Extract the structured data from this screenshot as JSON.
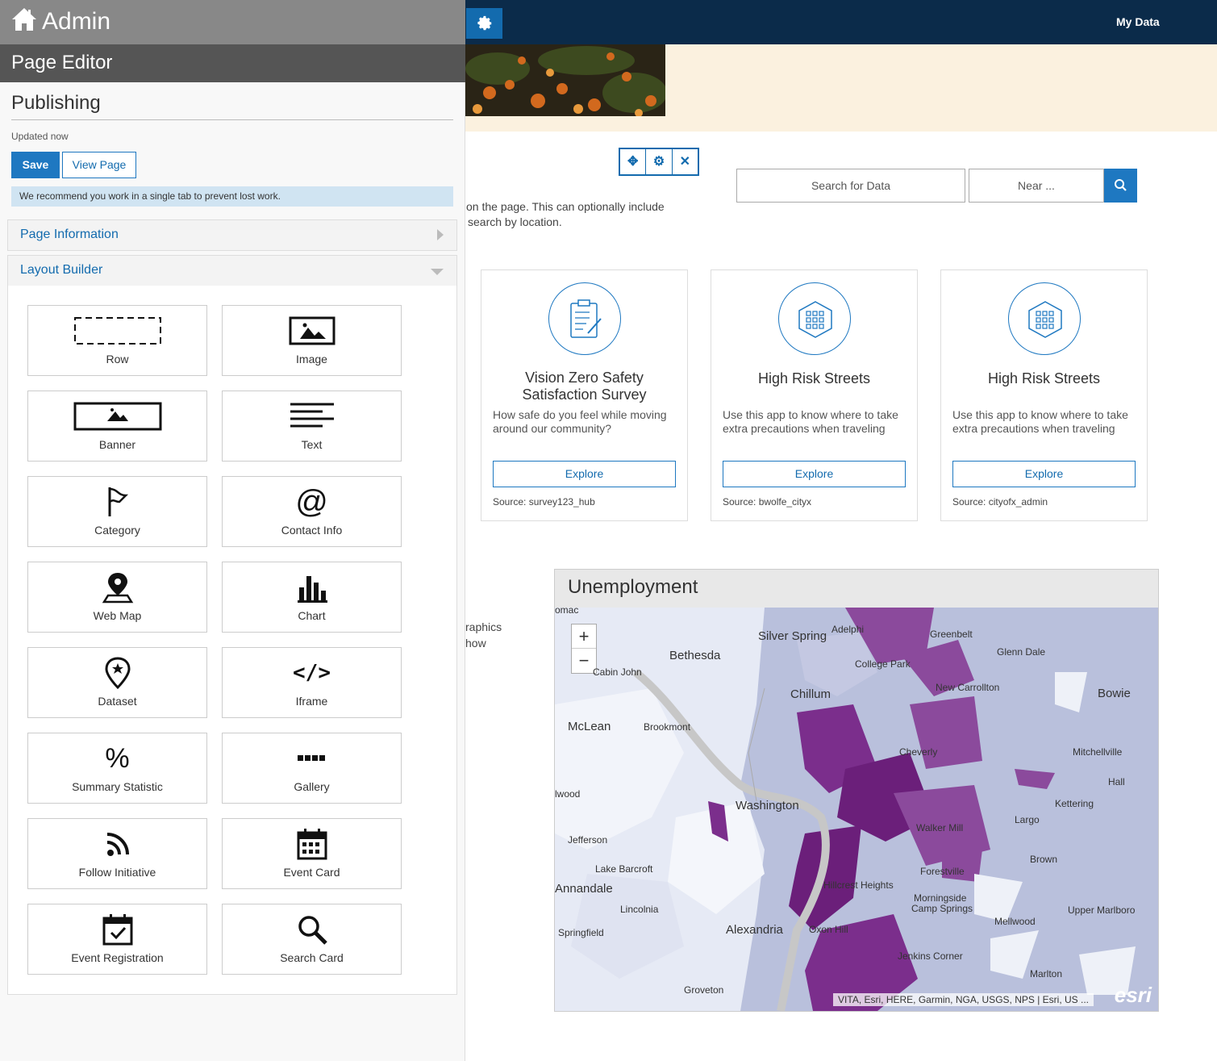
{
  "sidebar": {
    "admin_title": "Admin",
    "editor_title": "Page Editor",
    "publishing_title": "Publishing",
    "updated_text": "Updated now",
    "save_label": "Save",
    "view_page_label": "View Page",
    "notice": "We recommend you work in a single tab to prevent lost work.",
    "page_information": "Page Information",
    "layout_builder": "Layout Builder",
    "tiles": [
      {
        "label": "Row",
        "icon": "row-icon"
      },
      {
        "label": "Image",
        "icon": "image-icon"
      },
      {
        "label": "Banner",
        "icon": "banner-icon"
      },
      {
        "label": "Text",
        "icon": "text-icon"
      },
      {
        "label": "Category",
        "icon": "flag-icon"
      },
      {
        "label": "Contact Info",
        "icon": "at-icon"
      },
      {
        "label": "Web Map",
        "icon": "map-pin-icon"
      },
      {
        "label": "Chart",
        "icon": "bar-chart-icon"
      },
      {
        "label": "Dataset",
        "icon": "dataset-pin-icon"
      },
      {
        "label": "Iframe",
        "icon": "code-icon"
      },
      {
        "label": "Summary Statistic",
        "icon": "percent-icon"
      },
      {
        "label": "Gallery",
        "icon": "gallery-icon"
      },
      {
        "label": "Follow Initiative",
        "icon": "rss-icon"
      },
      {
        "label": "Event Card",
        "icon": "calendar-icon"
      },
      {
        "label": "Event Registration",
        "icon": "calendar-check-icon"
      },
      {
        "label": "Search Card",
        "icon": "search-icon"
      }
    ]
  },
  "header": {
    "my_data": "My Data"
  },
  "search": {
    "data_placeholder": "Search for Data",
    "near_placeholder": "Near ..."
  },
  "partial_text": {
    "line1": "on the page. This can optionally include",
    "line2": "search by location.",
    "line3": "raphics",
    "line4": "how"
  },
  "cards": [
    {
      "title": "Vision Zero Safety Satisfaction Survey",
      "desc": "How safe do you feel while moving around our community?",
      "button": "Explore",
      "source": "Source: survey123_hub"
    },
    {
      "title": "High Risk Streets",
      "desc": "Use this app to know where to take extra precautions when traveling",
      "button": "Explore",
      "source": "Source: bwolfe_cityx"
    },
    {
      "title": "High Risk Streets",
      "desc": "Use this app to know where to take extra precautions when traveling",
      "button": "Explore",
      "source": "Source: cityofx_admin"
    }
  ],
  "map": {
    "title": "Unemployment",
    "zoom_in": "+",
    "zoom_out": "−",
    "attribution": "VITA, Esri, HERE, Garmin, NGA, USGS, NPS | Esri, US ...",
    "logo_text": "esri",
    "labels": [
      "Silver Spring",
      "Bethesda",
      "Adelphi",
      "Greenbelt",
      "Glenn Dale",
      "College Park",
      "Cabin John",
      "New Carrollton",
      "Bowie",
      "Chillum",
      "McLean",
      "Brookmont",
      "Cheverly",
      "Mitchellville",
      "Hall",
      "Washington",
      "Kettering",
      "Largo",
      "Walker Mill",
      "Jefferson",
      "Lake Barcroft",
      "Brown",
      "Forestville",
      "Annandale",
      "Hillcrest Heights",
      "Morningside",
      "Camp Springs",
      "Lincolnia",
      "Upper Marlboro",
      "Mellwood",
      "Springfield",
      "Alexandria",
      "Oxon Hill",
      "Jenkins Corner",
      "Marlton",
      "Groveton",
      "lwood",
      "omac"
    ]
  },
  "colors": {
    "accent": "#1e78c1",
    "topbar": "#0b2b4a",
    "map_low": "#eef1f8",
    "map_mid": "#b9c0dc",
    "map_high": "#8b4a9c",
    "map_top": "#6b1f7a"
  }
}
